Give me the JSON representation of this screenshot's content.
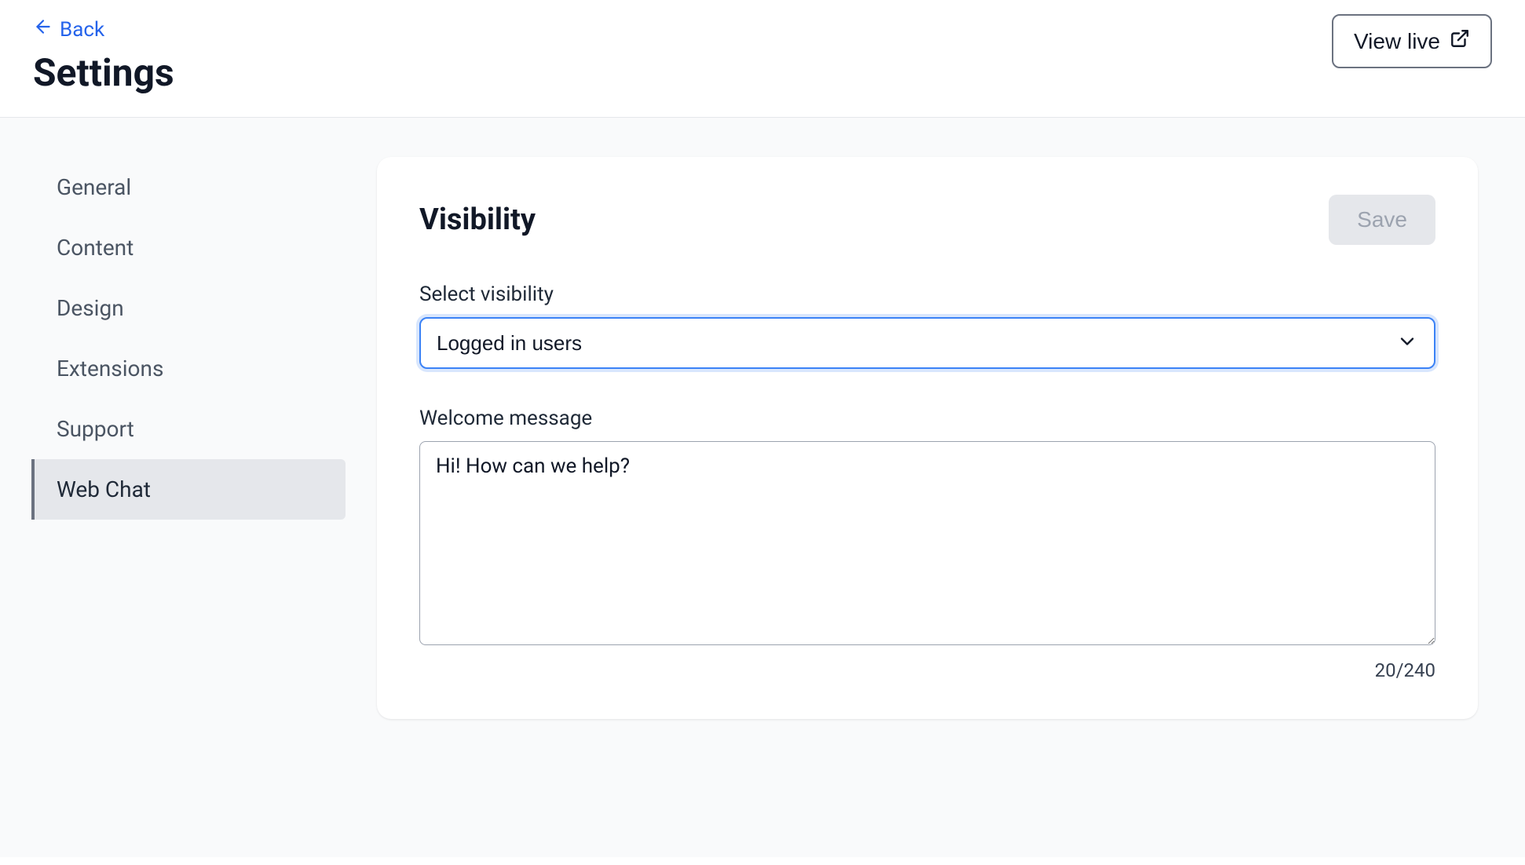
{
  "header": {
    "back_label": "Back",
    "title": "Settings",
    "view_live_label": "View live"
  },
  "sidebar": {
    "items": [
      {
        "label": "General",
        "active": false
      },
      {
        "label": "Content",
        "active": false
      },
      {
        "label": "Design",
        "active": false
      },
      {
        "label": "Extensions",
        "active": false
      },
      {
        "label": "Support",
        "active": false
      },
      {
        "label": "Web Chat",
        "active": true
      }
    ]
  },
  "card": {
    "title": "Visibility",
    "save_label": "Save",
    "visibility": {
      "label": "Select visibility",
      "value": "Logged in users"
    },
    "welcome": {
      "label": "Welcome message",
      "value": "Hi! How can we help?",
      "counter": "20/240"
    }
  }
}
